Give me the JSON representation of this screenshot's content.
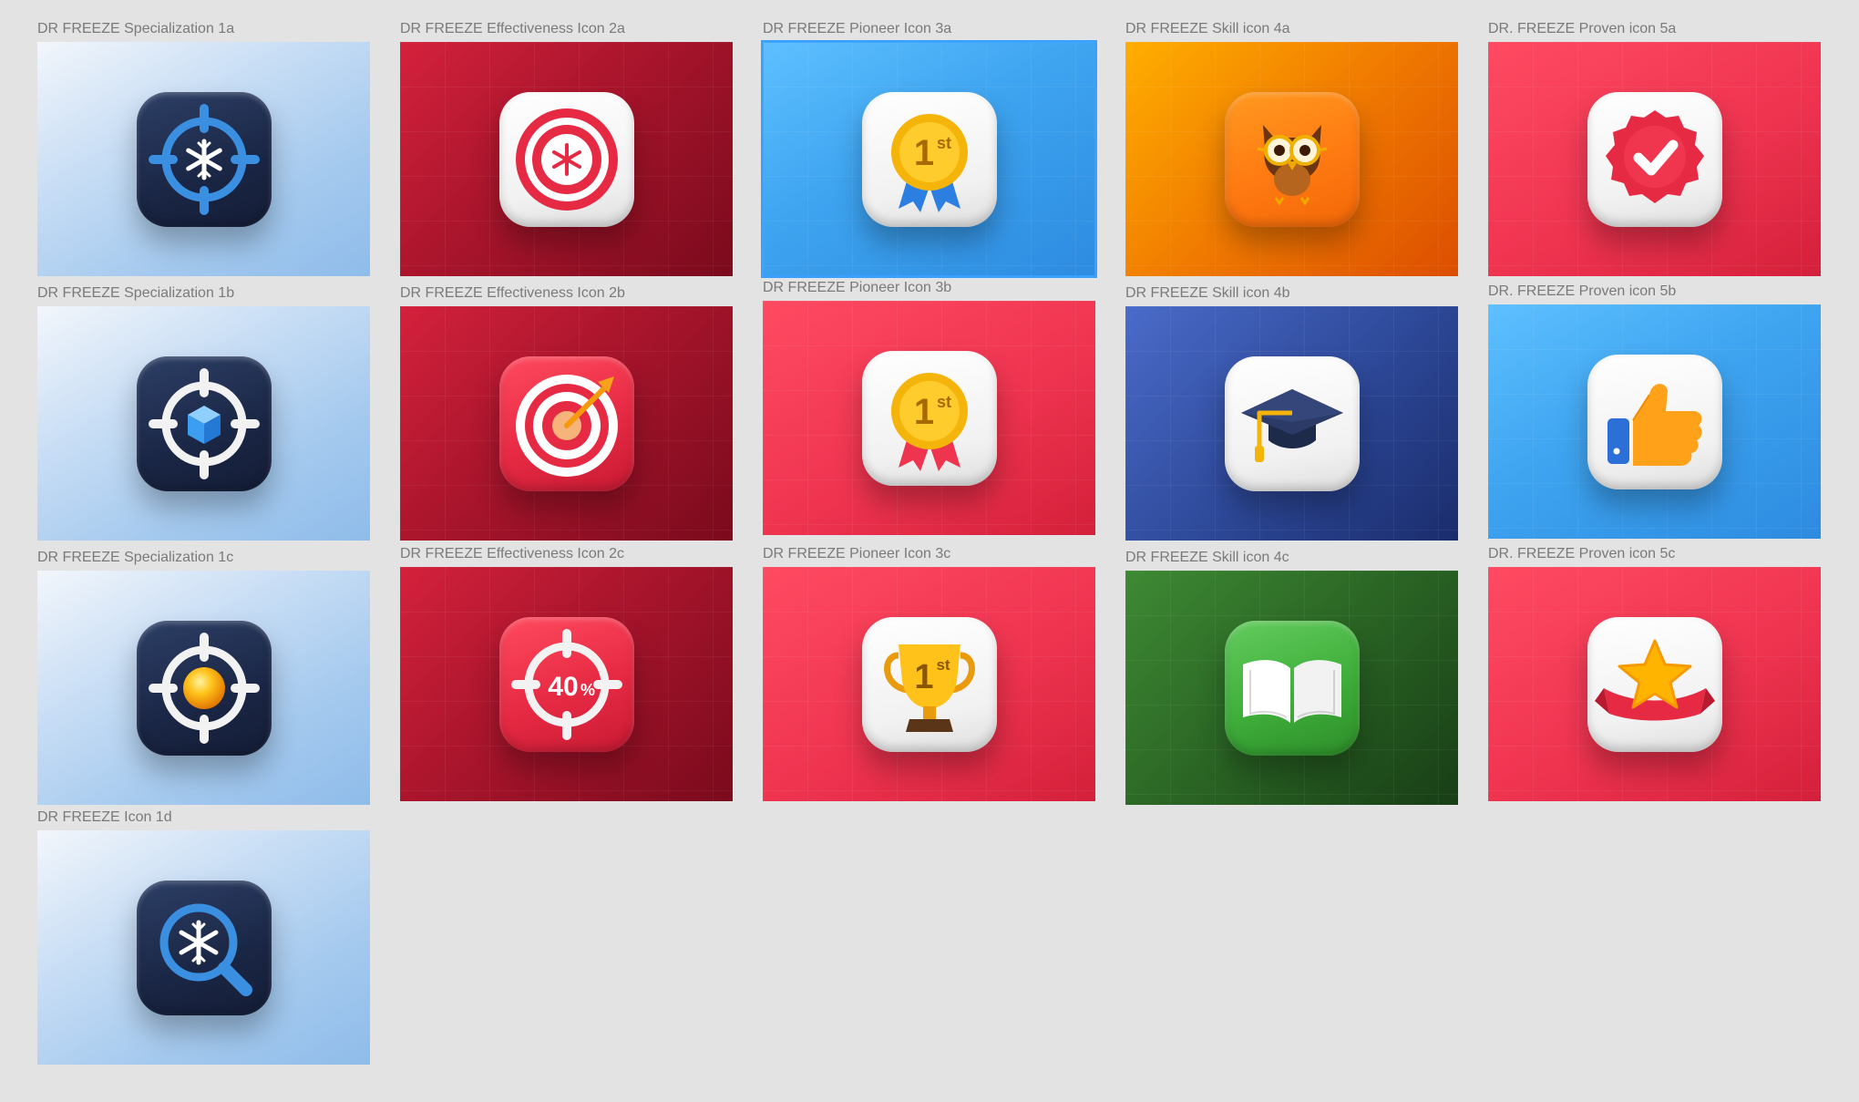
{
  "canvas": {
    "background": "#e3e3e3"
  },
  "artboards": [
    {
      "id": "1a",
      "label": "DR FREEZE Specialization 1a",
      "background": "blue-gradient",
      "icon": "target-snowflake-icon"
    },
    {
      "id": "1b",
      "label": "DR FREEZE Specialization 1b",
      "background": "blue-gradient",
      "icon": "target-cube-icon"
    },
    {
      "id": "1c",
      "label": "DR FREEZE Specialization 1c",
      "background": "blue-gradient",
      "icon": "target-sphere-icon"
    },
    {
      "id": "1d",
      "label": "DR FREEZE Icon 1d",
      "background": "blue-gradient",
      "icon": "magnifier-snowflake-icon"
    },
    {
      "id": "2a",
      "label": "DR FREEZE Effectiveness Icon 2a",
      "background": "dark-red-gradient",
      "icon": "bullseye-snowflake-icon"
    },
    {
      "id": "2b",
      "label": "DR FREEZE Effectiveness Icon 2b",
      "background": "dark-red-gradient",
      "icon": "dart-target-icon"
    },
    {
      "id": "2c",
      "label": "DR FREEZE Effectiveness Icon 2c",
      "background": "dark-red-gradient",
      "icon": "crosshair-percent-icon",
      "text": "40",
      "unit": "%"
    },
    {
      "id": "3a",
      "label": "DR FREEZE Pioneer Icon 3a",
      "background": "sky-blue-gradient",
      "icon": "first-place-medal-blue-icon",
      "selected": true,
      "text": "1",
      "suffix": "st"
    },
    {
      "id": "3b",
      "label": "DR FREEZE Pioneer Icon 3b",
      "background": "pink-gradient",
      "icon": "first-place-medal-red-icon",
      "text": "1",
      "suffix": "st"
    },
    {
      "id": "3c",
      "label": "DR FREEZE Pioneer Icon 3c",
      "background": "pink-gradient",
      "icon": "first-place-trophy-icon",
      "text": "1",
      "suffix": "st"
    },
    {
      "id": "4a",
      "label": "DR FREEZE Skill icon 4a",
      "background": "orange-gradient",
      "icon": "owl-glasses-icon"
    },
    {
      "id": "4b",
      "label": "DR FREEZE Skill icon 4b",
      "background": "navy-blue-gradient",
      "icon": "graduation-cap-icon"
    },
    {
      "id": "4c",
      "label": "DR FREEZE Skill icon 4c",
      "background": "green-gradient",
      "icon": "open-book-icon"
    },
    {
      "id": "5a",
      "label": "DR. FREEZE Proven icon 5a",
      "background": "pink-gradient",
      "icon": "verified-check-badge-icon"
    },
    {
      "id": "5b",
      "label": "DR. FREEZE Proven icon 5b",
      "background": "sky-blue-gradient",
      "icon": "thumbs-up-icon"
    },
    {
      "id": "5c",
      "label": "DR. FREEZE Proven icon 5c",
      "background": "pink-gradient",
      "icon": "star-ribbon-icon"
    }
  ],
  "colors": {
    "selection_outline": "#3aa0ff",
    "tile_navy": "#1e2a4a",
    "accent_blue": "#3b8fe0",
    "accent_red": "#e72a44",
    "gold": "#f5b40a"
  }
}
